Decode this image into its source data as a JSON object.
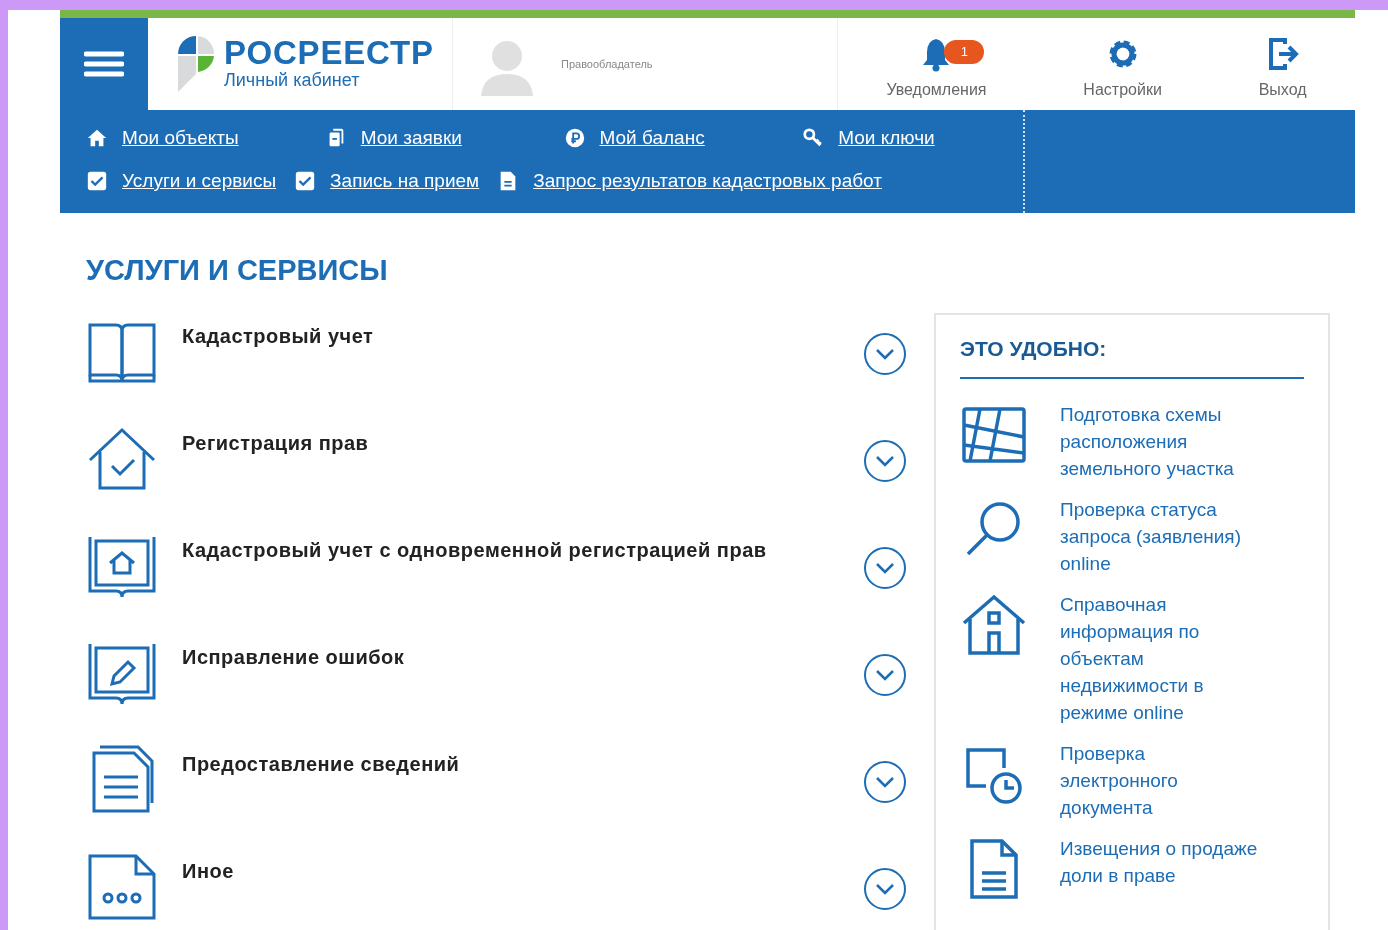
{
  "header": {
    "logo_title": "РОСРЕЕСТР",
    "logo_subtitle": "Личный кабинет",
    "user_role": "Правообладатель",
    "actions": [
      {
        "kind": "bell",
        "label": "Уведомления",
        "badge": "1"
      },
      {
        "kind": "gear",
        "label": "Настройки"
      },
      {
        "kind": "exit",
        "label": "Выход"
      }
    ]
  },
  "nav": {
    "rows": [
      [
        {
          "kind": "home",
          "label": "Мои объекты"
        },
        {
          "kind": "docs",
          "label": "Мои заявки"
        },
        {
          "kind": "ruble",
          "label": "Мой баланс"
        },
        {
          "kind": "key",
          "label": "Мои ключи"
        }
      ],
      [
        {
          "kind": "check",
          "label": "Услуги и сервисы"
        },
        {
          "kind": "check",
          "label": "Запись на прием"
        },
        {
          "kind": "file",
          "label": "Запрос результатов кадастровых работ"
        }
      ]
    ]
  },
  "page_title": "УСЛУГИ И СЕРВИСЫ",
  "services": [
    {
      "kind": "book",
      "title": "Кадастровый учет"
    },
    {
      "kind": "house",
      "title": "Регистрация прав"
    },
    {
      "kind": "bookhouse",
      "title": "Кадастровый учет с одновременной регистрацией прав"
    },
    {
      "kind": "bookpen",
      "title": "Исправление ошибок"
    },
    {
      "kind": "doc",
      "title": "Предоставление сведений"
    },
    {
      "kind": "dots",
      "title": "Иное"
    }
  ],
  "sidebar": {
    "title": "ЭТО УДОБНО:",
    "items": [
      {
        "kind": "map",
        "label": "Подготовка схемы расположения земельного участка"
      },
      {
        "kind": "search",
        "label": "Проверка статуса запроса (заявления) online"
      },
      {
        "kind": "house",
        "label": "Справочная информация по объектам недвижимости в режиме online"
      },
      {
        "kind": "monitor",
        "label": "Проверка электронного документа"
      },
      {
        "kind": "doc",
        "label": "Извещения о продаже доли в праве"
      }
    ]
  }
}
